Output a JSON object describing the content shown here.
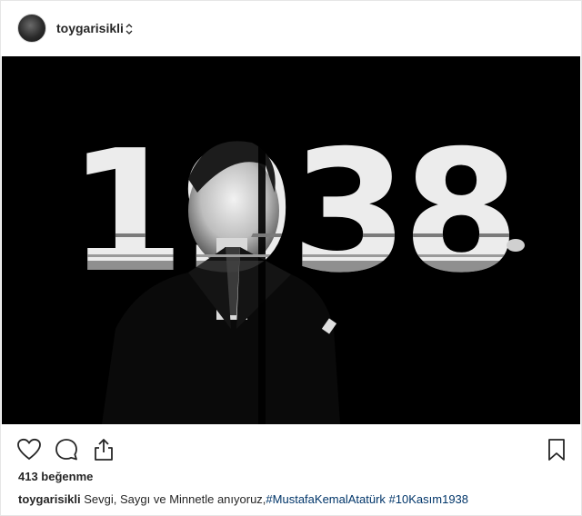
{
  "post": {
    "username": "toygarisikli",
    "image_text": "1938",
    "likes_label": "413 beğenme",
    "caption": {
      "username": "toygarisikli",
      "text": " Sevgi, Saygı ve Minnetle anıyoruz,",
      "hashtag1": "#MustafaKemalAtatürk",
      "hashtag2": "#10Kasım1938"
    }
  },
  "icons": {
    "like": "heart-icon",
    "comment": "comment-bubble-icon",
    "share": "share-icon",
    "save": "bookmark-icon"
  },
  "colors": {
    "photo_background": "#000000",
    "hashtag": "#003569",
    "text": "#262626"
  }
}
